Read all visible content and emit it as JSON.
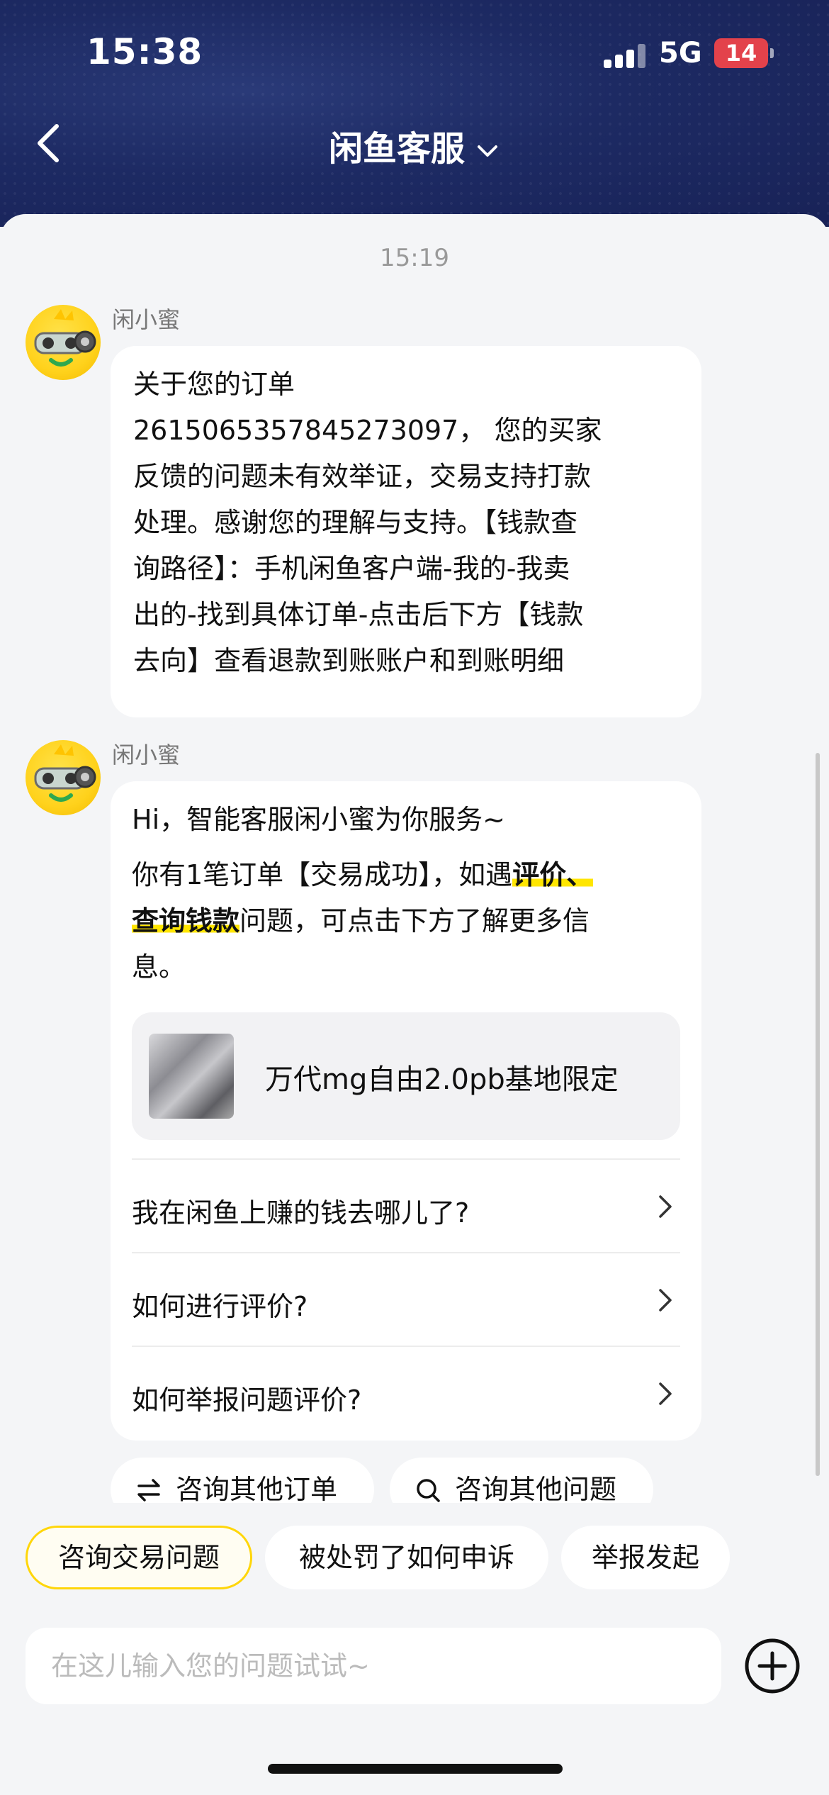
{
  "status": {
    "time": "15:38",
    "network": "5G",
    "battery": "14"
  },
  "nav": {
    "title": "闲鱼客服"
  },
  "chat": {
    "timestamp": "15:19",
    "messages": [
      {
        "sender": "闲小蜜",
        "lines": [
          "关于您的订单",
          "2615065357845273097， 您的买家",
          "反馈的问题未有效举证，交易支持打款",
          "处理。感谢您的理解与支持。【钱款查",
          "询路径】：手机闲鱼客户端-我的-我卖",
          "出的-找到具体订单-点击后下方【钱款",
          "去向】查看退款到账账户和到账明细"
        ]
      },
      {
        "sender": "闲小蜜",
        "greeting": "Hi，智能客服闲小蜜为你服务~",
        "line1_a": "你有1笔订单【交易成功】，如遇",
        "line1_hl": "评价、",
        "line2_hl": "查询钱款",
        "line2_b": "问题，可点击下方了解更多信",
        "line3": "息。",
        "product": {
          "name": "万代mg自由2.0pb基地限定"
        },
        "faqs": [
          {
            "label": "我在闲鱼上赚的钱去哪儿了?"
          },
          {
            "label": "如何进行评价?"
          },
          {
            "label": "如何举报问题评价?"
          }
        ]
      }
    ],
    "quick_actions": [
      {
        "label": "咨询其他订单",
        "icon": "swap-icon"
      },
      {
        "label": "咨询其他问题",
        "icon": "search-icon"
      }
    ]
  },
  "suggestions": [
    {
      "label": "咨询交易问题",
      "active": true
    },
    {
      "label": "被处罚了如何申诉",
      "active": false
    },
    {
      "label": "举报发起",
      "active": false
    }
  ],
  "input": {
    "placeholder": "在这儿输入您的问题试试~"
  },
  "colors": {
    "header": "#1d2a63",
    "highlight": "#ffe600",
    "active_border": "#ffd60a",
    "battery": "#e3424b"
  }
}
